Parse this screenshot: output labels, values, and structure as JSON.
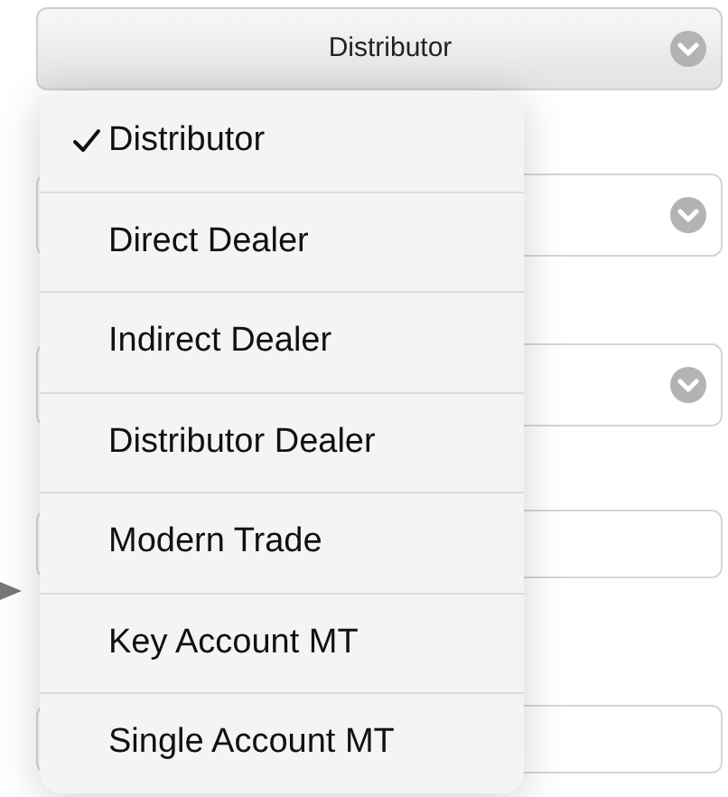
{
  "top_select": {
    "value": "Distributor"
  },
  "background_fields": [
    {
      "kind": "select"
    },
    {
      "kind": "select"
    },
    {
      "kind": "input"
    },
    {
      "kind": "input"
    }
  ],
  "menu": {
    "items": [
      {
        "label": "Distributor",
        "selected": true
      },
      {
        "label": "Direct Dealer",
        "selected": false
      },
      {
        "label": "Indirect Dealer",
        "selected": false
      },
      {
        "label": "Distributor Dealer",
        "selected": false
      },
      {
        "label": "Modern Trade",
        "selected": false
      },
      {
        "label": "Key Account MT",
        "selected": false
      },
      {
        "label": "Single Account MT",
        "selected": false
      }
    ]
  }
}
